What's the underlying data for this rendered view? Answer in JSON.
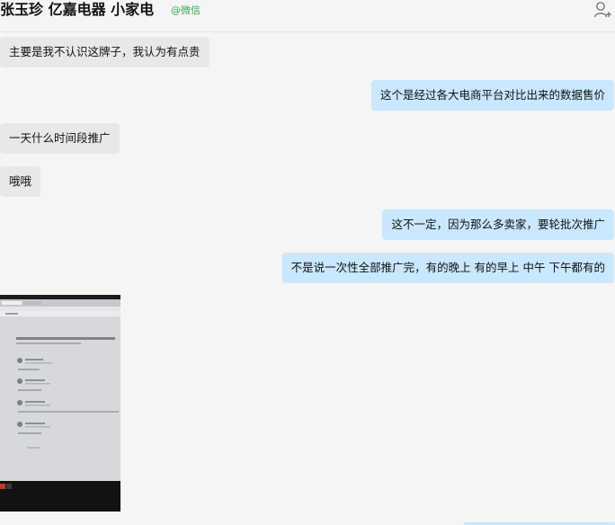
{
  "header": {
    "title": "张玉珍 亿嘉电器  小家电",
    "source": "@微信",
    "add_icon": "add-member-icon"
  },
  "messages": [
    {
      "side": "left",
      "text": "主要是我不认识这牌子，我认为有点贵"
    },
    {
      "side": "right",
      "text": "这个是经过各大电商平台对比出来的数据售价"
    },
    {
      "side": "left",
      "text": "一天什么时间段推广"
    },
    {
      "side": "left",
      "text": "哦哦"
    },
    {
      "side": "right",
      "text": "这不一定，因为那么多卖家，要轮批次推广"
    },
    {
      "side": "right",
      "text": "不是说一次性全部推广完，有的晚上 有的早上 中午 下午都有的"
    }
  ],
  "colors": {
    "background": "#f5f5f5",
    "incoming_bubble": "#e8e8e8",
    "outgoing_bubble": "#c9e7ff",
    "source_tag": "#3aa84a"
  }
}
